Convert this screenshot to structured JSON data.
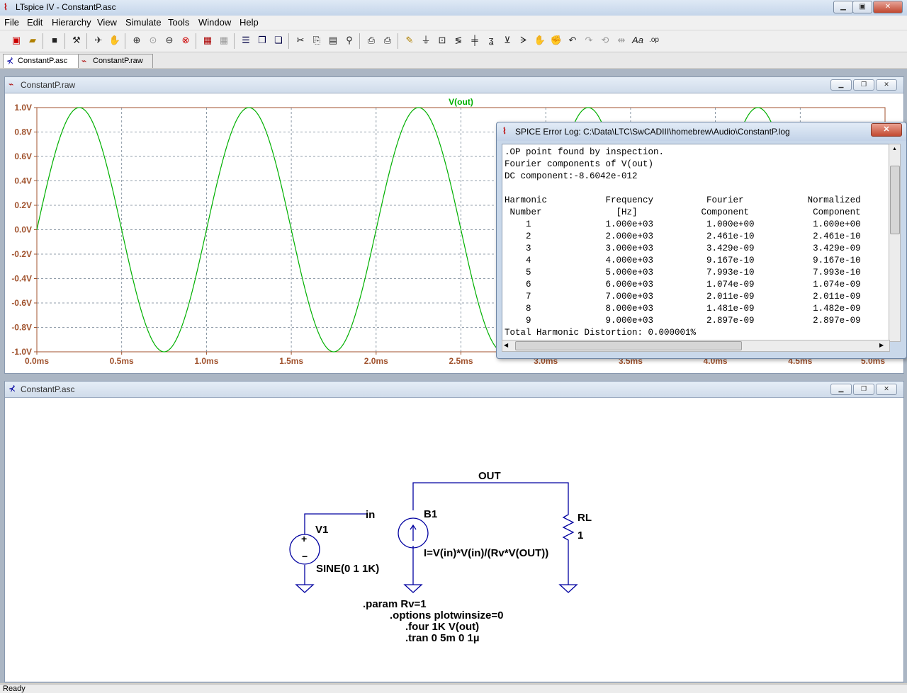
{
  "window": {
    "title": "LTspice IV - ConstantP.asc",
    "minimize_label": "▁",
    "maximize_label": "▣",
    "close_label": "✕"
  },
  "menu": [
    "File",
    "Edit",
    "Hierarchy",
    "View",
    "Simulate",
    "Tools",
    "Window",
    "Help"
  ],
  "doc_tabs": [
    {
      "label": "ConstantP.asc",
      "active": true
    },
    {
      "label": "ConstantP.raw",
      "active": false
    }
  ],
  "plot_window": {
    "title": "ConstantP.raw",
    "trace_label": "V(out)",
    "trace_color": "#00b000"
  },
  "chart_data": {
    "type": "line",
    "title": "",
    "x_tick_labels": [
      "0.0ms",
      "0.5ms",
      "1.0ms",
      "1.5ms",
      "2.0ms",
      "2.5ms",
      "3.0ms",
      "3.5ms",
      "4.0ms",
      "4.5ms",
      "5.0ms"
    ],
    "y_tick_labels": [
      "1.0V",
      "0.8V",
      "0.6V",
      "0.4V",
      "0.2V",
      "0.0V",
      "-0.2V",
      "-0.4V",
      "-0.6V",
      "-0.8V",
      "-1.0V"
    ],
    "xlim_ms": [
      0,
      5
    ],
    "ylim": [
      -1,
      1
    ],
    "grid": true,
    "series": [
      {
        "name": "V(out)",
        "amplitude": 1.0,
        "frequency_hz": 1000,
        "offset": 0
      }
    ]
  },
  "error_log": {
    "title": "SPICE Error Log: C:\\Data\\LTC\\SwCADIII\\homebrew\\Audio\\ConstantP.log",
    "close_label": "✕",
    "text": ".OP point found by inspection.\nFourier components of V(out)\nDC component:-8.6042e-012\n\nHarmonic           Frequency          Fourier            Normalized\n Number              [Hz]            Component            Component\n    1              1.000e+03          1.000e+00           1.000e+00\n    2              2.000e+03          2.461e-10           2.461e-10\n    3              3.000e+03          3.429e-09           3.429e-09\n    4              4.000e+03          9.167e-10           9.167e-10\n    5              5.000e+03          7.993e-10           7.993e-10\n    6              6.000e+03          1.074e-09           1.074e-09\n    7              7.000e+03          2.011e-09           2.011e-09\n    8              8.000e+03          1.481e-09           1.482e-09\n    9              9.000e+03          2.897e-09           2.897e-09\nTotal Harmonic Distortion: 0.000001%"
  },
  "schematic_window": {
    "title": "ConstantP.asc",
    "labels": {
      "out_net": "OUT",
      "in_net": "in",
      "v1_name": "V1",
      "v1_value": "SINE(0 1 1K)",
      "b1_name": "B1",
      "b1_expr": "I=V(in)*V(in)/(Rv*V(OUT))",
      "rl_name": "RL",
      "rl_value": "1",
      "param": ".param Rv=1",
      "options": ".options plotwinsize=0",
      "four": ".four 1K V(out)",
      "tran": ".tran 0 5m 0 1µ"
    },
    "wire_color": "#0000a0"
  },
  "status_text": "Ready"
}
